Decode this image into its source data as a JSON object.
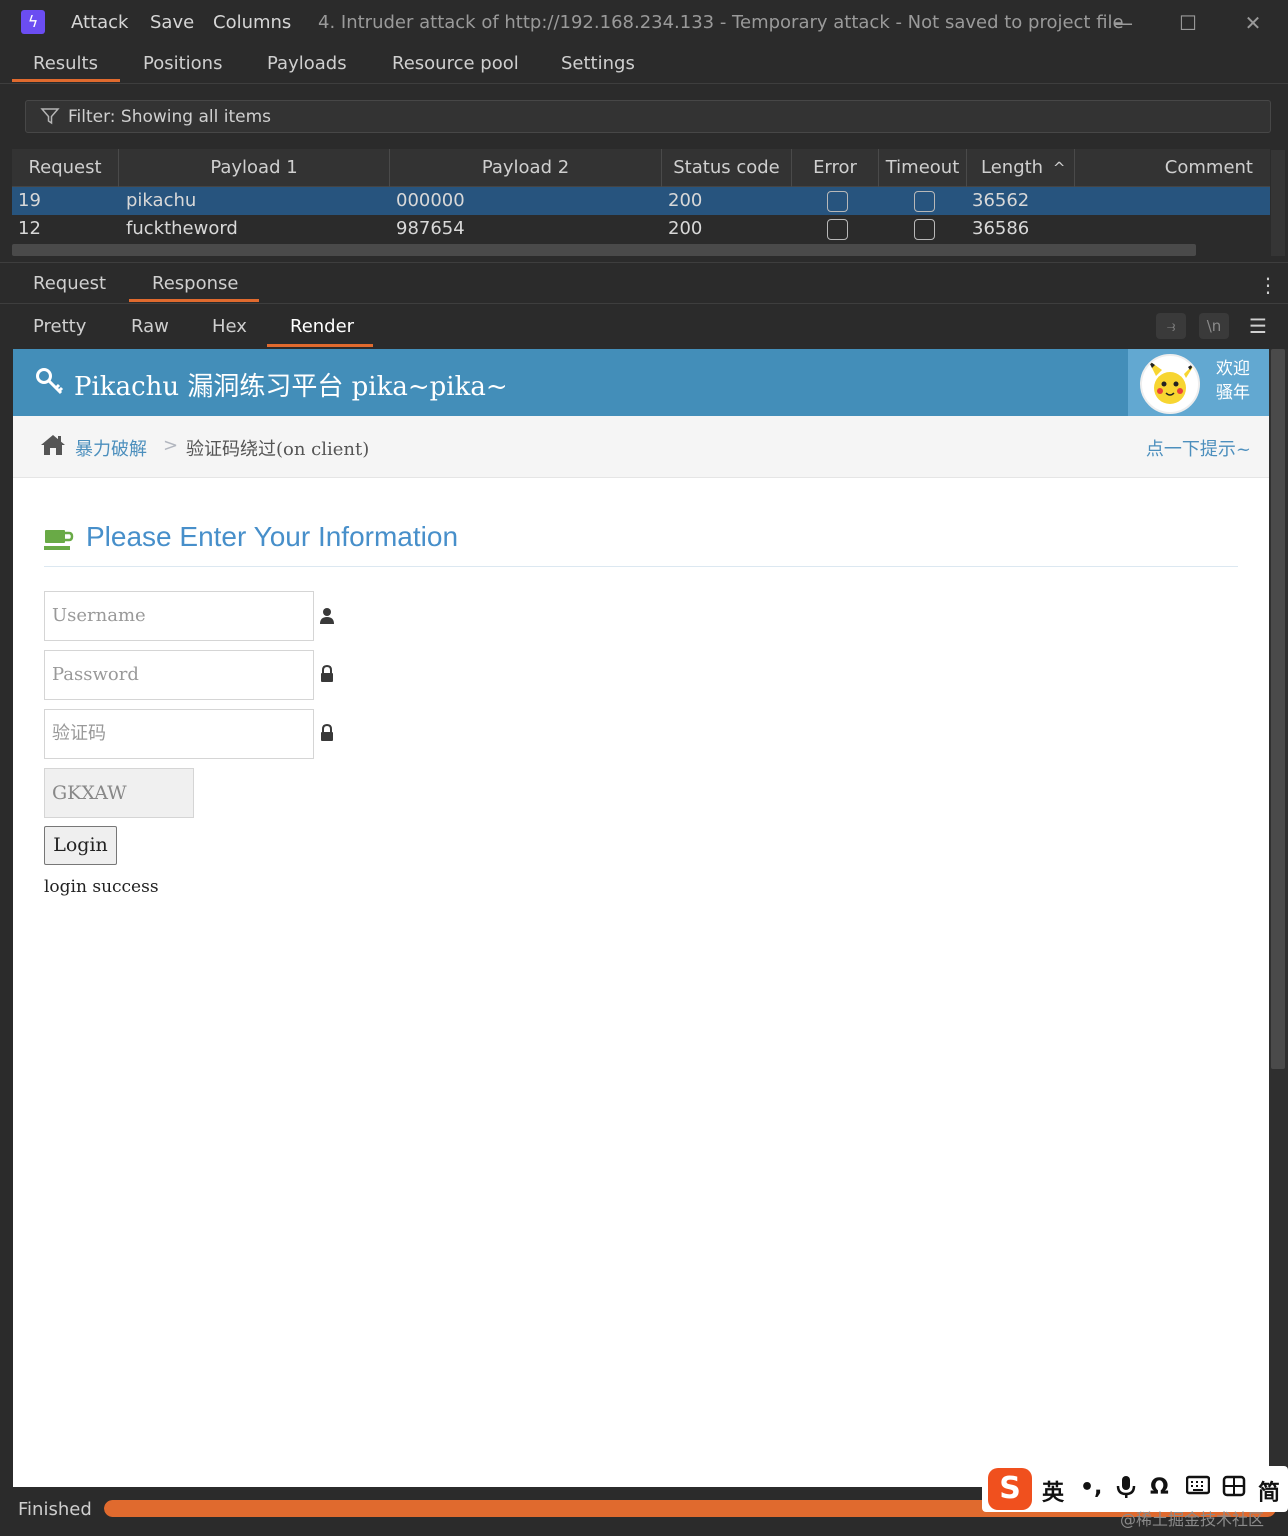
{
  "titlebar": {
    "menu": [
      "Attack",
      "Save",
      "Columns"
    ],
    "title": "4. Intruder attack of http://192.168.234.133 - Temporary attack - Not saved to project file"
  },
  "main_tabs": [
    "Results",
    "Positions",
    "Payloads",
    "Resource pool",
    "Settings"
  ],
  "filter": {
    "label": "Filter: Showing all items"
  },
  "results_table": {
    "columns": [
      "Request",
      "Payload 1",
      "Payload 2",
      "Status code",
      "Error",
      "Timeout",
      "Length",
      "Comment"
    ],
    "sort_indicator": "^",
    "rows": [
      {
        "request": "19",
        "payload1": "pikachu",
        "payload2": "000000",
        "status": "200",
        "length": "36562",
        "selected": true
      },
      {
        "request": "12",
        "payload1": "fucktheword",
        "payload2": "987654",
        "status": "200",
        "length": "36586",
        "selected": false
      }
    ]
  },
  "message_tabs": [
    "Request",
    "Response"
  ],
  "view_tabs": [
    "Pretty",
    "Raw",
    "Hex",
    "Render"
  ],
  "toolbar": {
    "newline_label": "\\n"
  },
  "render": {
    "site_title": "Pikachu 漏洞练习平台 pika~pika~",
    "welcome_line1": "欢迎",
    "welcome_line2": "骚年",
    "breadcrumb_link": "暴力破解",
    "breadcrumb_sep": ">",
    "breadcrumb_current": "验证码绕过(on client)",
    "hint": "点一下提示~",
    "heading": "Please Enter Your Information",
    "username_placeholder": "Username",
    "password_placeholder": "Password",
    "captcha_placeholder": "验证码",
    "captcha_code": "GKXAW",
    "login_label": "Login",
    "message": "login success"
  },
  "status": {
    "text": "Finished",
    "progress": 1.0
  },
  "ime": {
    "items": [
      "英",
      "•,",
      "简"
    ]
  },
  "watermark": "@稀土掘金技术社区",
  "colors": {
    "accent": "#e06a2e",
    "selected_row": "#27547e",
    "pikachu_header": "#438eb9",
    "link_blue": "#4c8fbd"
  }
}
